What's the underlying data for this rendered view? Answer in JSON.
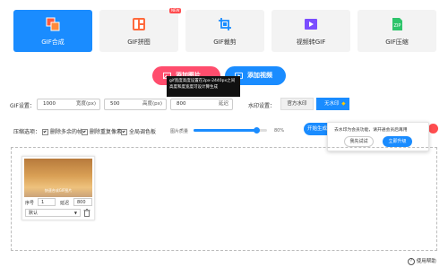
{
  "tabs": [
    {
      "label": "GIF合成",
      "icon": "gif-compose-icon"
    },
    {
      "label": "GIF拼图",
      "icon": "gif-puzzle-icon"
    },
    {
      "label": "GIF裁剪",
      "icon": "gif-crop-icon"
    },
    {
      "label": "视频转GIF",
      "icon": "video-to-gif-icon"
    },
    {
      "label": "GIF压缩",
      "icon": "gif-compress-icon"
    }
  ],
  "new_badge": "NEW",
  "actions": {
    "add_image": "添加图片",
    "add_video": "添加视频"
  },
  "tooltip": {
    "line1": "gif宽度高度设置在2px-2440px之间",
    "line2": "高度和度宽度可设计算生成"
  },
  "settings": {
    "label": "GIF设置：",
    "width": {
      "value": "1000",
      "unit": "宽度(px)"
    },
    "height": {
      "value": "500",
      "unit": "高度(px)"
    },
    "speed": {
      "value": "800",
      "unit": "延迟"
    },
    "watermark_label": "水印设置：",
    "official_watermark": "官方水印",
    "no_watermark": "无水印"
  },
  "compression": {
    "label": "压缩选项：",
    "opt1": "删除多余的帧",
    "opt2": "删除重复像素",
    "opt3": "全局调色板",
    "quality_label": "图片质量",
    "quality_value": "80%",
    "quality_fraction": 0.85,
    "generate": "开始生成gif"
  },
  "member_popup": {
    "text": "去水印为会员功能，请开通会员后再用",
    "trial": "我先试试",
    "upgrade": "立即升级"
  },
  "frame": {
    "caption": "快速合成GIF图片",
    "seq_label": "序号",
    "seq_value": "1",
    "delay_label": "延迟",
    "delay_value": "800",
    "effect_value": "默认"
  },
  "help": "使用帮助"
}
